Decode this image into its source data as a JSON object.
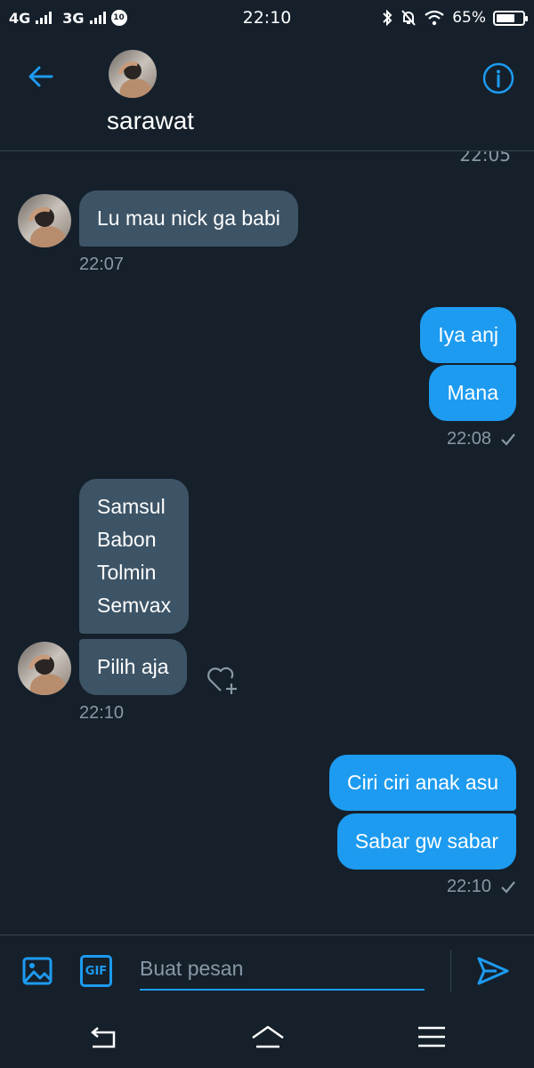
{
  "status_bar": {
    "network1": "4G",
    "network2": "3G",
    "badge": "10",
    "time": "22:10",
    "battery": "65%"
  },
  "header": {
    "contact_name": "sarawat"
  },
  "conversation": {
    "cut_off_time": "22:05",
    "incoming_1": {
      "text": "Lu mau nick ga babi",
      "time": "22:07"
    },
    "outgoing_1": {
      "messages": [
        "Iya anj",
        "Mana"
      ],
      "time": "22:08"
    },
    "incoming_2": {
      "messages": [
        "Samsul\nBabon\nTolmin\nSemvax",
        "Pilih aja"
      ],
      "time": "22:10"
    },
    "outgoing_2": {
      "messages": [
        "Ciri ciri anak asu",
        "Sabar gw sabar"
      ],
      "time": "22:10"
    }
  },
  "compose": {
    "gif_label": "GIF",
    "placeholder": "Buat pesan"
  },
  "colors": {
    "background": "#15202b",
    "incoming_bubble": "#3d5466",
    "outgoing_bubble": "#1d9bf0",
    "accent": "#1d9bf0",
    "muted_text": "#8899a6"
  },
  "icons": [
    "back-arrow-icon",
    "info-icon",
    "check-icon",
    "heart-add-icon",
    "image-icon",
    "gif-icon",
    "send-icon",
    "nav-back-icon",
    "nav-home-icon",
    "nav-menu-icon"
  ]
}
